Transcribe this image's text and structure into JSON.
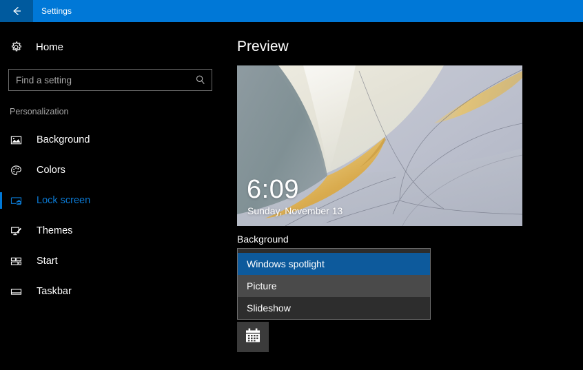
{
  "titlebar": {
    "back_icon": "back-arrow-icon",
    "title": "Settings",
    "accent_color": "#0078d7",
    "back_color": "#005a9e"
  },
  "sidebar": {
    "home": {
      "icon": "gear-icon",
      "label": "Home"
    },
    "search": {
      "icon": "search-icon",
      "placeholder": "Find a setting",
      "value": ""
    },
    "group_title": "Personalization",
    "items": [
      {
        "icon": "picture-icon",
        "label": "Background",
        "selected": false
      },
      {
        "icon": "palette-icon",
        "label": "Colors",
        "selected": false
      },
      {
        "icon": "lock-screen-icon",
        "label": "Lock screen",
        "selected": true
      },
      {
        "icon": "themes-brush-icon",
        "label": "Themes",
        "selected": false
      },
      {
        "icon": "start-tiles-icon",
        "label": "Start",
        "selected": false
      },
      {
        "icon": "taskbar-icon",
        "label": "Taskbar",
        "selected": false
      }
    ],
    "selected_color": "#0b7ad4"
  },
  "main": {
    "page_title": "Preview",
    "preview": {
      "clock": "6:09",
      "date": "Sunday, November 13",
      "wallpaper": "windows-hero-abstract"
    },
    "background_section": {
      "label": "Background",
      "selected_value": "Windows spotlight",
      "options": [
        {
          "label": "Windows spotlight",
          "state": "selected"
        },
        {
          "label": "Picture",
          "state": "hover"
        },
        {
          "label": "Slideshow",
          "state": "normal"
        }
      ],
      "selected_color": "#0d5a9c",
      "hover_color": "#4a4a4a"
    },
    "calendar_tile": {
      "icon": "calendar-icon"
    }
  }
}
